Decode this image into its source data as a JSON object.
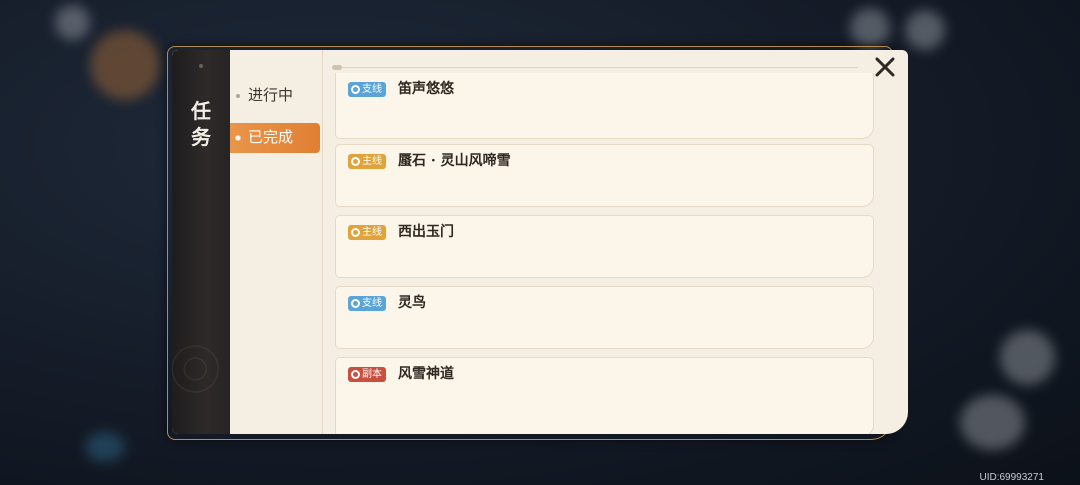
{
  "panel": {
    "title": "任务",
    "close_icon": "close-x-icon"
  },
  "tabs": [
    {
      "label": "进行中",
      "active": false
    },
    {
      "label": "已完成",
      "active": true
    }
  ],
  "quests": [
    {
      "tag": "支线",
      "tag_color": "#5aa4d8",
      "name": "笛声悠悠"
    },
    {
      "tag": "主线",
      "tag_color": "#e0a43a",
      "name": "蜃石 · 灵山风啼雪"
    },
    {
      "tag": "主线",
      "tag_color": "#e0a43a",
      "name": "西出玉门"
    },
    {
      "tag": "支线",
      "tag_color": "#5aa4d8",
      "name": "灵鸟"
    },
    {
      "tag": "副本",
      "tag_color": "#c9503f",
      "name": "风雪神道"
    }
  ],
  "footer": {
    "uid": "UID:69993271"
  },
  "colors": {
    "accent": "#e0853a",
    "panel_bg": "#f4eee3",
    "title_strip": "#262323"
  }
}
